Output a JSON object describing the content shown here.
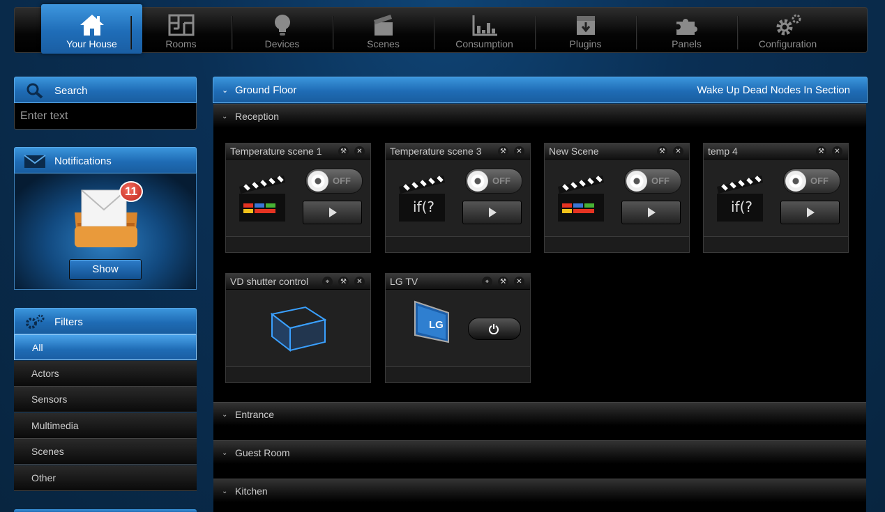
{
  "nav": {
    "tabs": [
      {
        "label": "Your House",
        "icon": "house-icon",
        "active": true
      },
      {
        "label": "Rooms",
        "icon": "floor-plan-icon"
      },
      {
        "label": "Devices",
        "icon": "light-bulb-icon"
      },
      {
        "label": "Scenes",
        "icon": "clapperboard-icon"
      },
      {
        "label": "Consumption",
        "icon": "bar-chart-icon"
      },
      {
        "label": "Plugins",
        "icon": "download-box-icon"
      },
      {
        "label": "Panels",
        "icon": "puzzle-icon"
      },
      {
        "label": "Configuration",
        "icon": "gears-icon"
      }
    ]
  },
  "sidebar": {
    "search": {
      "title": "Search",
      "placeholder": "Enter text"
    },
    "notifications": {
      "title": "Notifications",
      "count": "11",
      "show_label": "Show"
    },
    "filters": {
      "title": "Filters",
      "items": [
        "All",
        "Actors",
        "Sensors",
        "Multimedia",
        "Scenes",
        "Other"
      ],
      "active": "All"
    }
  },
  "main": {
    "section_title": "Ground Floor",
    "wake_label": "Wake Up Dead Nodes In Section",
    "rooms": [
      {
        "name": "Reception",
        "expanded": true
      },
      {
        "name": "Entrance"
      },
      {
        "name": "Guest Room"
      },
      {
        "name": "Kitchen"
      }
    ],
    "cards": [
      {
        "title": "Temperature scene 1",
        "kind": "scene-colors",
        "toggle": "OFF"
      },
      {
        "title": "Temperature scene 3",
        "kind": "scene-if",
        "toggle": "OFF",
        "if_text": "if(?"
      },
      {
        "title": "New Scene",
        "kind": "scene-colors",
        "toggle": "OFF"
      },
      {
        "title": "temp 4",
        "kind": "scene-if",
        "toggle": "OFF",
        "if_text": "if(?"
      },
      {
        "title": "VD shutter control",
        "kind": "cube"
      },
      {
        "title": "LG TV",
        "kind": "tv",
        "brand": "LG"
      }
    ]
  },
  "colors": {
    "accent_blue": "#1f6cb5",
    "badge_red": "#c0241b",
    "background": "#0a2f54"
  }
}
